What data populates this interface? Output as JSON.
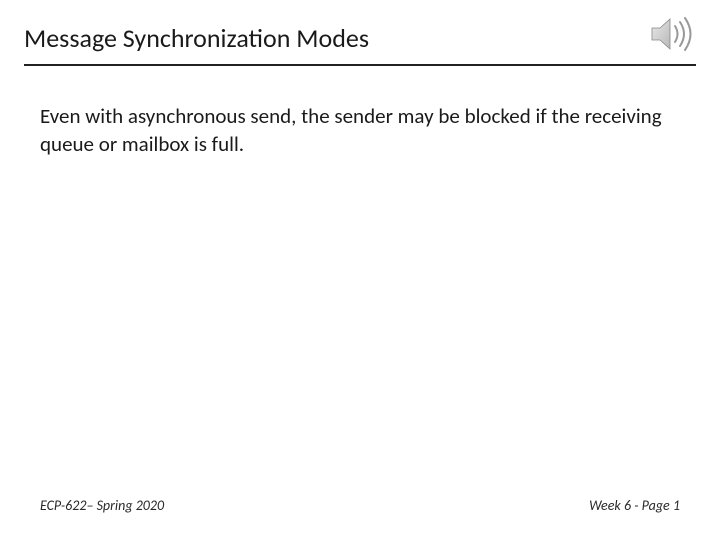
{
  "slide": {
    "title": "Message Synchronization Modes",
    "body": "Even with asynchronous send, the sender may be blocked if the receiving queue or mailbox is full.",
    "footer_left": "ECP-622– Spring 2020",
    "footer_right": "Week 6 - Page 1"
  }
}
